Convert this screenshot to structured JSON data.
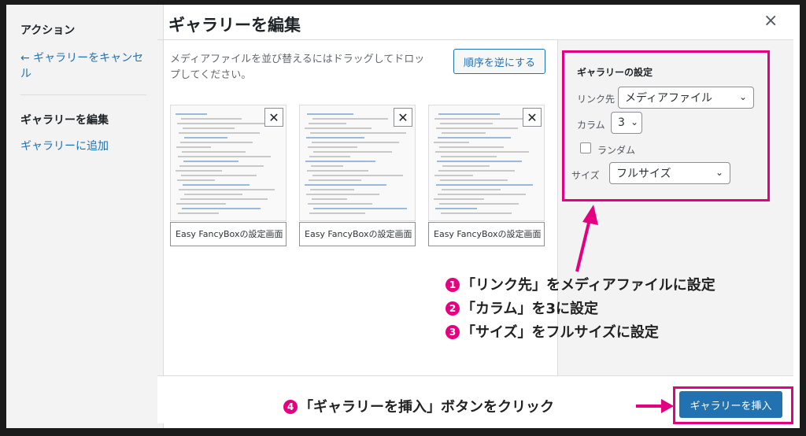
{
  "sidebar": {
    "actions_heading": "アクション",
    "cancel_link": "← ギャラリーをキャンセル",
    "edit_heading": "ギャラリーを編集",
    "add_link": "ギャラリーに追加"
  },
  "modal": {
    "title": "ギャラリーを編集",
    "close_glyph": "×",
    "instructions": "メディアファイルを並び替えるにはドラッグしてドロップしてください。",
    "reverse_label": "順序を逆にする"
  },
  "gallery": {
    "remove_glyph": "✕",
    "items": [
      {
        "caption": "Easy FancyBoxの設定画面"
      },
      {
        "caption": "Easy FancyBoxの設定画面"
      },
      {
        "caption": "Easy FancyBoxの設定画面"
      }
    ]
  },
  "settings": {
    "title": "ギャラリーの設定",
    "link_label": "リンク先",
    "link_value": "メディアファイル",
    "columns_label": "カラム",
    "columns_value": "3",
    "random_label": "ランダム",
    "random_checked": false,
    "size_label": "サイズ",
    "size_value": "フルサイズ"
  },
  "footer": {
    "insert_label": "ギャラリーを挿入"
  },
  "annotations": {
    "step1": {
      "num": "1",
      "text": "「リンク先」をメディアファイルに設定"
    },
    "step2": {
      "num": "2",
      "text": "「カラム」を3に設定"
    },
    "step3": {
      "num": "3",
      "text": "「サイズ」をフルサイズに設定"
    },
    "step4": {
      "num": "4",
      "text": "「ギャラリーを挿入」ボタンをクリック"
    }
  },
  "colors": {
    "accent": "#2271b1",
    "highlight": "#e4007f"
  },
  "icons": {
    "close": "close-icon",
    "remove": "remove-icon",
    "chevron": "chevron-down-icon"
  }
}
